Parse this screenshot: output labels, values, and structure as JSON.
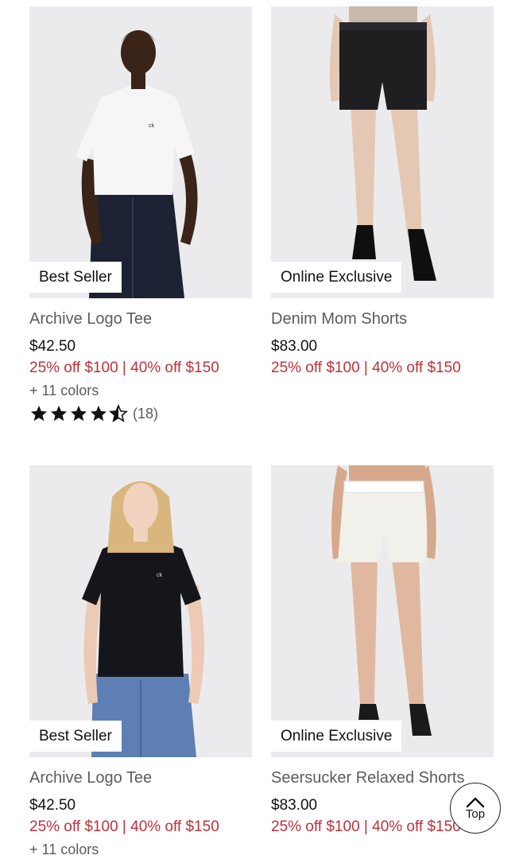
{
  "products": [
    {
      "badge": "Best Seller",
      "title": "Archive Logo Tee",
      "price": "$42.50",
      "promo": "25% off $100 | 40% off $150",
      "colors": "+ 11 colors",
      "rating_value": 4.5,
      "rating_count": "(18)"
    },
    {
      "badge": "Online Exclusive",
      "title": "Denim Mom Shorts",
      "price": "$83.00",
      "promo": "25% off $100 | 40% off $150"
    },
    {
      "badge": "Best Seller",
      "title": "Archive Logo Tee",
      "price": "$42.50",
      "promo": "25% off $100 | 40% off $150",
      "colors": "+ 11 colors"
    },
    {
      "badge": "Online Exclusive",
      "title": "Seersucker Relaxed Shorts",
      "price": "$83.00",
      "promo": "25% off $100 | 40% off $150"
    }
  ],
  "top_button": {
    "label": "Top"
  },
  "colors": {
    "promo": "#c0303a",
    "image_bg": "#ebebed"
  }
}
